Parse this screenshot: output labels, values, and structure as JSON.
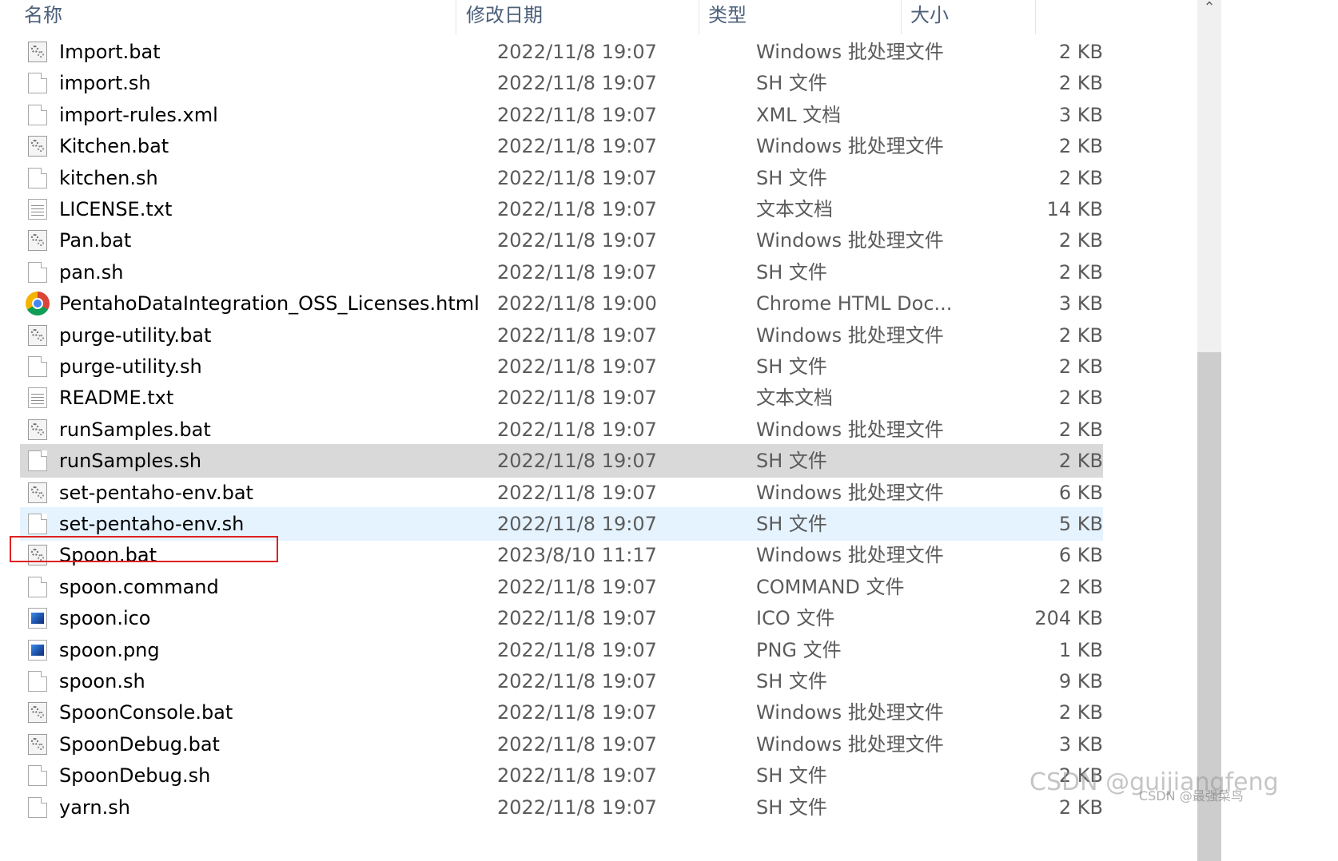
{
  "columns": {
    "name": "名称",
    "date": "修改日期",
    "type": "类型",
    "size": "大小"
  },
  "files": [
    {
      "name": "Import.bat",
      "date": "2022/11/8 19:07",
      "type": "Windows 批处理文件",
      "size": "2 KB",
      "icon": "bat-file-icon",
      "state": ""
    },
    {
      "name": "import.sh",
      "date": "2022/11/8 19:07",
      "type": "SH 文件",
      "size": "2 KB",
      "icon": "file-icon",
      "state": ""
    },
    {
      "name": "import-rules.xml",
      "date": "2022/11/8 19:07",
      "type": "XML 文档",
      "size": "3 KB",
      "icon": "file-icon",
      "state": ""
    },
    {
      "name": "Kitchen.bat",
      "date": "2022/11/8 19:07",
      "type": "Windows 批处理文件",
      "size": "2 KB",
      "icon": "bat-file-icon",
      "state": ""
    },
    {
      "name": "kitchen.sh",
      "date": "2022/11/8 19:07",
      "type": "SH 文件",
      "size": "2 KB",
      "icon": "file-icon",
      "state": ""
    },
    {
      "name": "LICENSE.txt",
      "date": "2022/11/8 19:07",
      "type": "文本文档",
      "size": "14 KB",
      "icon": "text-file-icon",
      "state": ""
    },
    {
      "name": "Pan.bat",
      "date": "2022/11/8 19:07",
      "type": "Windows 批处理文件",
      "size": "2 KB",
      "icon": "bat-file-icon",
      "state": ""
    },
    {
      "name": "pan.sh",
      "date": "2022/11/8 19:07",
      "type": "SH 文件",
      "size": "2 KB",
      "icon": "file-icon",
      "state": ""
    },
    {
      "name": "PentahoDataIntegration_OSS_Licenses.html",
      "date": "2022/11/8 19:00",
      "type": "Chrome HTML Doc...",
      "size": "3 KB",
      "icon": "chrome-icon",
      "state": ""
    },
    {
      "name": "purge-utility.bat",
      "date": "2022/11/8 19:07",
      "type": "Windows 批处理文件",
      "size": "2 KB",
      "icon": "bat-file-icon",
      "state": ""
    },
    {
      "name": "purge-utility.sh",
      "date": "2022/11/8 19:07",
      "type": "SH 文件",
      "size": "2 KB",
      "icon": "file-icon",
      "state": ""
    },
    {
      "name": "README.txt",
      "date": "2022/11/8 19:07",
      "type": "文本文档",
      "size": "2 KB",
      "icon": "text-file-icon",
      "state": ""
    },
    {
      "name": "runSamples.bat",
      "date": "2022/11/8 19:07",
      "type": "Windows 批处理文件",
      "size": "2 KB",
      "icon": "bat-file-icon",
      "state": ""
    },
    {
      "name": "runSamples.sh",
      "date": "2022/11/8 19:07",
      "type": "SH 文件",
      "size": "2 KB",
      "icon": "file-icon",
      "state": "selected"
    },
    {
      "name": "set-pentaho-env.bat",
      "date": "2022/11/8 19:07",
      "type": "Windows 批处理文件",
      "size": "6 KB",
      "icon": "bat-file-icon",
      "state": ""
    },
    {
      "name": "set-pentaho-env.sh",
      "date": "2022/11/8 19:07",
      "type": "SH 文件",
      "size": "5 KB",
      "icon": "file-icon",
      "state": "hover"
    },
    {
      "name": "Spoon.bat",
      "date": "2023/8/10 11:17",
      "type": "Windows 批处理文件",
      "size": "6 KB",
      "icon": "bat-file-icon",
      "state": "highlighted"
    },
    {
      "name": "spoon.command",
      "date": "2022/11/8 19:07",
      "type": "COMMAND 文件",
      "size": "2 KB",
      "icon": "file-icon",
      "state": ""
    },
    {
      "name": "spoon.ico",
      "date": "2022/11/8 19:07",
      "type": "ICO 文件",
      "size": "204 KB",
      "icon": "image-file-icon",
      "state": ""
    },
    {
      "name": "spoon.png",
      "date": "2022/11/8 19:07",
      "type": "PNG 文件",
      "size": "1 KB",
      "icon": "image-file-icon",
      "state": ""
    },
    {
      "name": "spoon.sh",
      "date": "2022/11/8 19:07",
      "type": "SH 文件",
      "size": "9 KB",
      "icon": "file-icon",
      "state": ""
    },
    {
      "name": "SpoonConsole.bat",
      "date": "2022/11/8 19:07",
      "type": "Windows 批处理文件",
      "size": "2 KB",
      "icon": "bat-file-icon",
      "state": ""
    },
    {
      "name": "SpoonDebug.bat",
      "date": "2022/11/8 19:07",
      "type": "Windows 批处理文件",
      "size": "3 KB",
      "icon": "bat-file-icon",
      "state": ""
    },
    {
      "name": "SpoonDebug.sh",
      "date": "2022/11/8 19:07",
      "type": "SH 文件",
      "size": "2 KB",
      "icon": "file-icon",
      "state": ""
    },
    {
      "name": "yarn.sh",
      "date": "2022/11/8 19:07",
      "type": "SH 文件",
      "size": "2 KB",
      "icon": "file-icon",
      "state": ""
    }
  ],
  "scroll_up_glyph": "⌃",
  "watermark": "CSDN @guijiangfeng",
  "watermark_small": "CSDN @最强菜鸟",
  "colors": {
    "header_text": "#4c607a",
    "selected_row": "#d9d9d9",
    "hover_row": "#e5f3ff",
    "highlight_box": "#e02020"
  }
}
